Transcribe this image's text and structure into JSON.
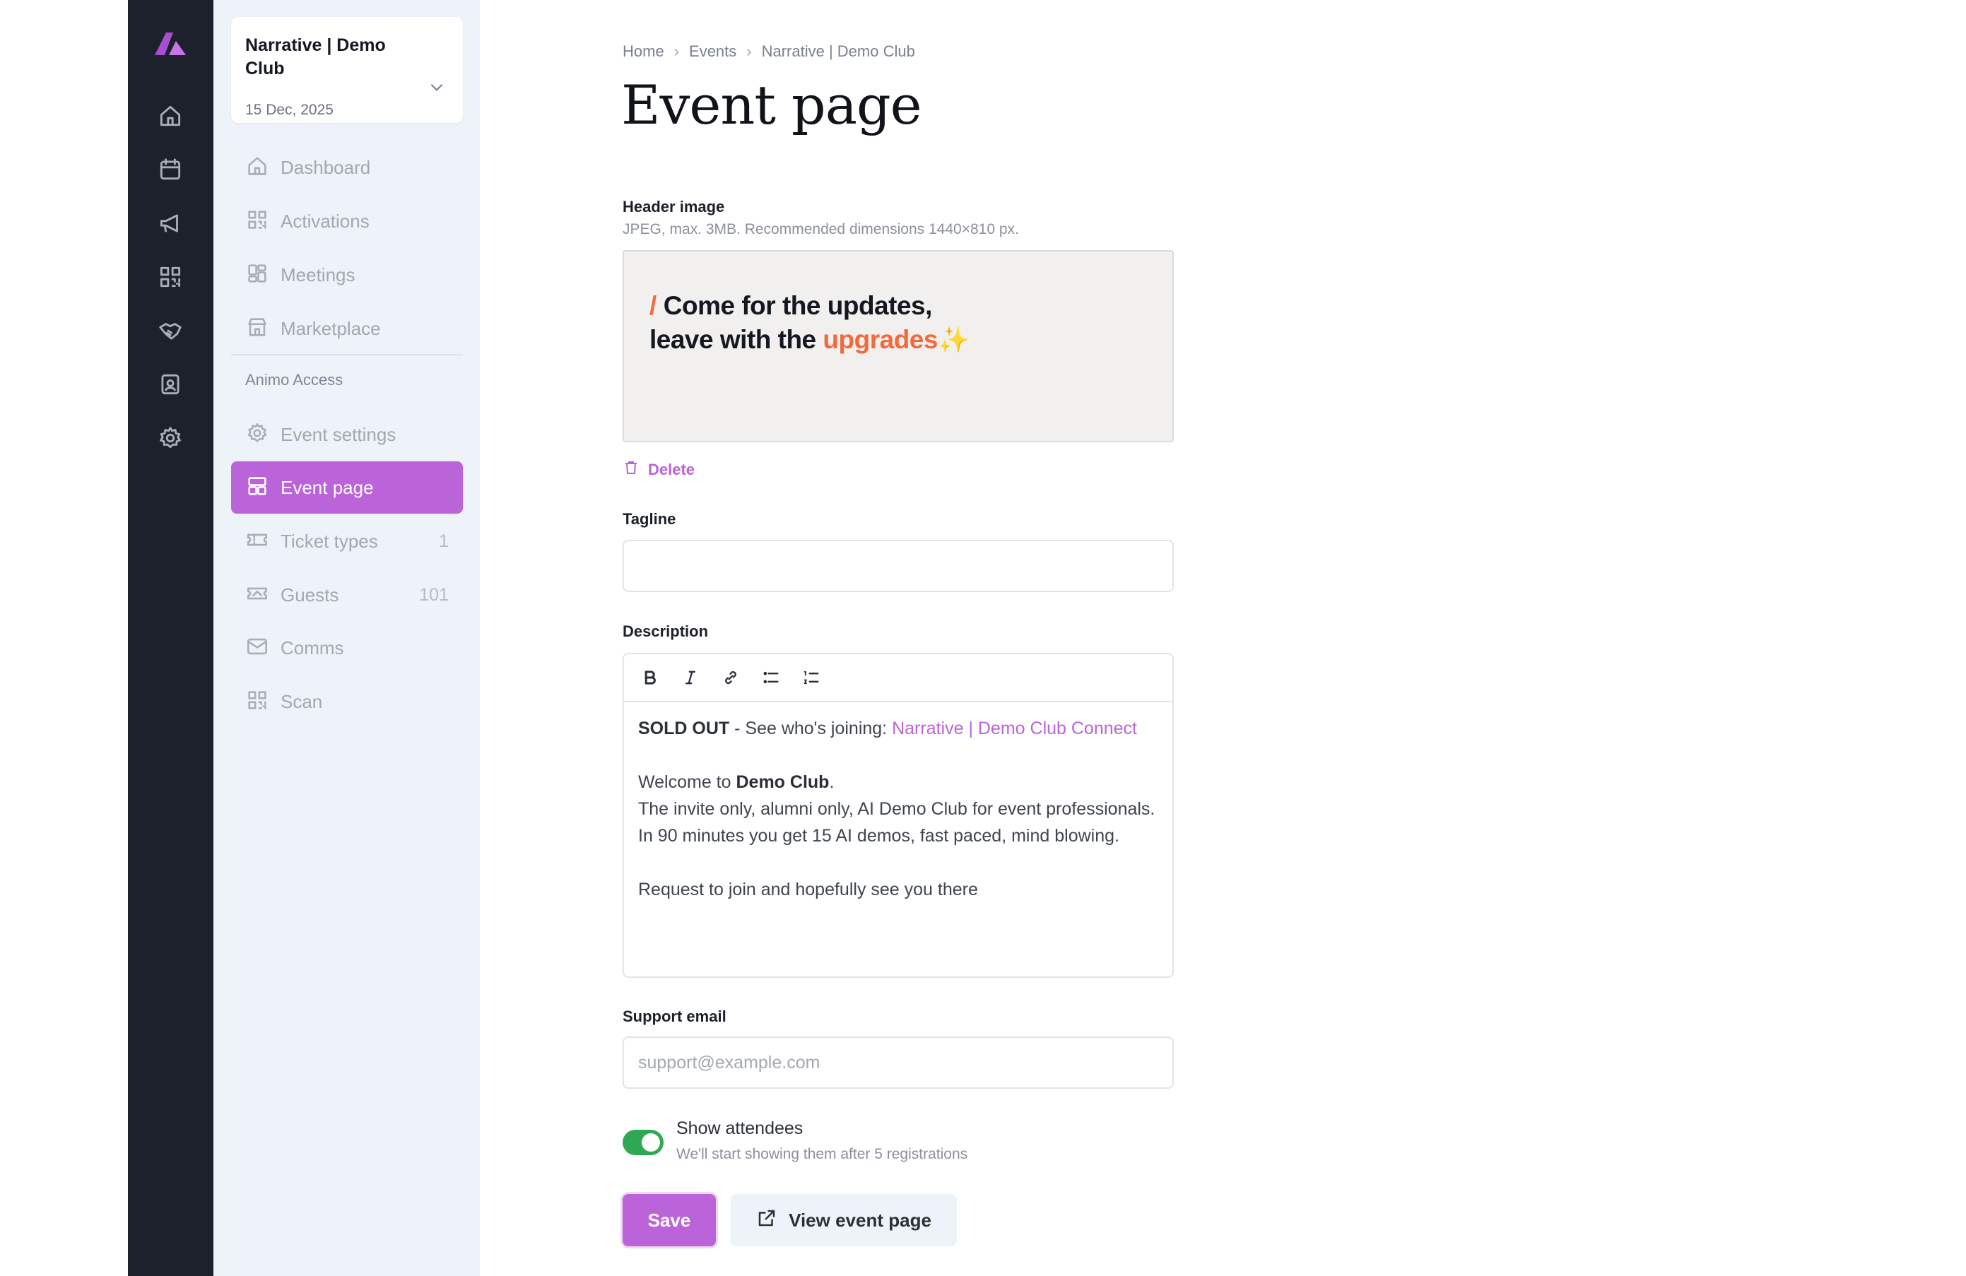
{
  "event_switcher": {
    "title": "Narrative | Demo Club",
    "date": "15 Dec, 2025"
  },
  "rail": {
    "items": [
      "home-icon",
      "calendar-icon",
      "megaphone-icon",
      "qr-icon",
      "handshake-icon",
      "badge-icon",
      "gear-icon"
    ]
  },
  "sidebar": {
    "items": [
      {
        "label": "Dashboard",
        "icon": "home-icon"
      },
      {
        "label": "Activations",
        "icon": "qr-icon"
      },
      {
        "label": "Meetings",
        "icon": "grid-icon"
      },
      {
        "label": "Marketplace",
        "icon": "store-icon"
      }
    ],
    "section_title": "Animo Access",
    "section_items": [
      {
        "label": "Event settings",
        "icon": "gear-icon"
      },
      {
        "label": "Event page",
        "icon": "layout-icon",
        "active": true
      },
      {
        "label": "Ticket types",
        "icon": "ticket-icon",
        "count": "1"
      },
      {
        "label": "Guests",
        "icon": "guest-ticket-icon",
        "count": "101"
      },
      {
        "label": "Comms",
        "icon": "mail-icon"
      },
      {
        "label": "Scan",
        "icon": "qr-icon"
      }
    ]
  },
  "breadcrumb": [
    "Home",
    "Events",
    "Narrative | Demo Club"
  ],
  "page_title": "Event page",
  "header_image": {
    "label": "Header image",
    "hint": "JPEG, max. 3MB. Recommended dimensions 1440×810 px.",
    "preview_slash": "/",
    "preview_line1": "Come for the updates,",
    "preview_line2_plain": "leave with the",
    "preview_line2_accent": "upgrades",
    "preview_spark": "✨",
    "delete_label": "Delete"
  },
  "tagline": {
    "label": "Tagline",
    "value": ""
  },
  "description": {
    "label": "Description",
    "toolbar": [
      "bold-icon",
      "italic-icon",
      "link-icon",
      "bullet-list-icon",
      "numbered-list-icon"
    ],
    "sold_out": "SOLD OUT",
    "see_whos_joining": " - See who's joining: ",
    "connect_link": "Narrative | Demo Club Connect",
    "welcome_prefix": "Welcome to ",
    "welcome_bold": "Demo Club",
    "welcome_suffix": ".",
    "line2": "The invite only, alumni only, AI Demo Club for event professionals.",
    "line3": "In 90 minutes you get 15 AI demos, fast paced, mind blowing.",
    "line4": "Request to join and hopefully see you there"
  },
  "support_email": {
    "label": "Support email",
    "placeholder": "support@example.com",
    "value": ""
  },
  "show_attendees": {
    "label": "Show attendees",
    "hint": "We'll start showing them after 5 registrations",
    "enabled": true
  },
  "actions": {
    "save": "Save",
    "view": "View event page"
  },
  "colors": {
    "accent": "#bb63d9",
    "rail_bg": "#1d212b",
    "sidebar_bg": "#eef3fa",
    "toggle_on": "#2fa855",
    "brand_orange": "#f26a3d"
  }
}
